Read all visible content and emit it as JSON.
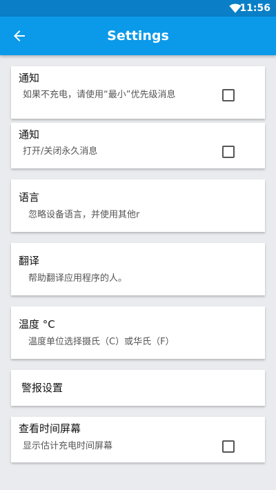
{
  "status": {
    "time": "11:56",
    "wifi_icon": "wifi-icon"
  },
  "appbar": {
    "title": "Settings",
    "back_icon": "arrow-left-icon"
  },
  "items": [
    {
      "title": "通知",
      "subtitle": "如果不充电，请使用“最小”优先级消息",
      "checked": false
    },
    {
      "title": "通知",
      "subtitle": "打开/关闭永久消息",
      "checked": false
    },
    {
      "title": "语言",
      "subtitle": "忽略设备语言，并使用其他r"
    },
    {
      "title": "翻译",
      "subtitle": "帮助翻译应用程序的人。"
    },
    {
      "title": "温度 °C",
      "subtitle": "温度单位选择摄氏（C）或华氏（F）"
    },
    {
      "title": "警报设置"
    },
    {
      "title": "查看时间屏幕",
      "subtitle": "显示估计充电时间屏幕",
      "checked": false
    }
  ],
  "colors": {
    "statusbar": "#0a7fc7",
    "appbar": "#0b9ae9",
    "background": "#e9ebee"
  }
}
